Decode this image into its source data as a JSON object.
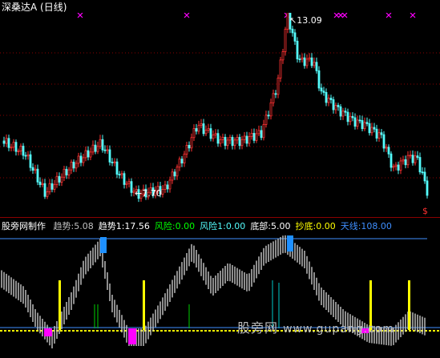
{
  "title": "深桑达A (日线)",
  "main": {
    "high_label": "13.09",
    "low_label": "7.70",
    "dollar_mark": "$",
    "colors": {
      "up": "#ff3232",
      "down": "#54fcfc",
      "grid": "#8a0000",
      "marker": "#ff00ff"
    }
  },
  "indicator": {
    "name": "股旁网制作",
    "items": [
      {
        "label": "趋势:5.08",
        "color": "#c0c0c0"
      },
      {
        "label": "趋势1:17.56",
        "color": "#ffffff"
      },
      {
        "label": "风险:0.00",
        "color": "#00ff00"
      },
      {
        "label": "风险1:0.00",
        "color": "#54fcfc"
      },
      {
        "label": "底部:5.00",
        "color": "#ffffff"
      },
      {
        "label": "抄底:0.00",
        "color": "#ffff00"
      },
      {
        "label": "天线:108.00",
        "color": "#3f8fff"
      }
    ],
    "colors": {
      "band": "#c8c8c8",
      "blue": "#1e90ff",
      "magenta": "#ff00ff",
      "yellow": "#ffff00",
      "green": "#00d000",
      "cyan": "#00c8c8",
      "antenna": "#3f8fff"
    }
  },
  "watermark": {
    "text": "股旁网",
    "domain": "www.gupang.com"
  }
}
